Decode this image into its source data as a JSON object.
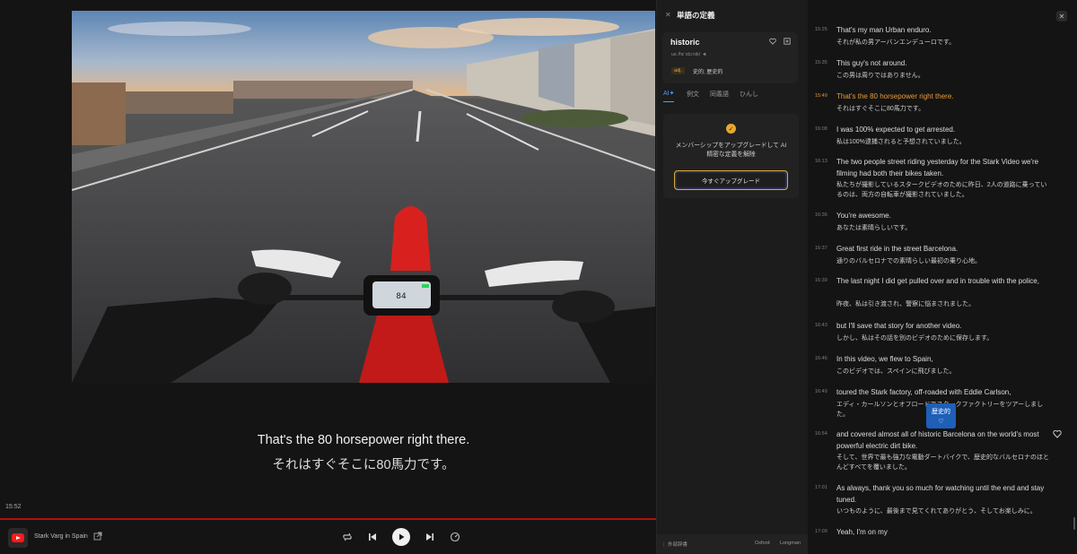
{
  "player": {
    "subtitle_en": "That's the 80 horsepower right there.",
    "subtitle_ja": "それはすぐそこに80馬力です。",
    "current_time": "15:52",
    "video_title": "Stark Varg in Spain",
    "dash_speed": "84"
  },
  "dictionary": {
    "title": "単語の定義",
    "word": "historic",
    "pronunciation": "us  /hɪˈstɔːrɪk/ ◄",
    "pos": "adj.",
    "meaning": "史的; 歴史的",
    "tabs": [
      "AI✦",
      "例文",
      "同義語",
      "ひんし"
    ],
    "upgrade_text": "メンバーシップをアップグレードして AI 精密な定義を解除",
    "upgrade_button": "今すぐアップグレード",
    "footer_left": "⋮ 外部辞書",
    "footer_oxford": "Oxford",
    "footer_longman": "Longman"
  },
  "transcript": {
    "lines": [
      {
        "ts": "15:25",
        "en": "That's my man Urban enduro.",
        "ja": "それが私の男アーバンエンデューロです。"
      },
      {
        "ts": "15:35",
        "en": "This guy's not around.",
        "ja": "この男は周りではありません。"
      },
      {
        "ts": "15:49",
        "en": "That's the 80 horsepower right there.",
        "ja": "それはすぐそこに80馬力です。"
      },
      {
        "ts": "16:08",
        "en": "I was 100% expected to get arrested.",
        "ja": "私は100%逮捕されると予想されていました。"
      },
      {
        "ts": "16:13",
        "en": "The two people street riding yesterday for the Stark Video we're filming had both their bikes taken.",
        "ja": "私たちが撮影しているスタークビデオのために昨日、2人の道路に乗っているのは、両方の自転車が撮影されていました。"
      },
      {
        "ts": "16:36",
        "en": "You're awesome.",
        "ja": "あなたは素晴らしいです。"
      },
      {
        "ts": "16:37",
        "en": "Great first ride in the street Barcelona.",
        "ja": "通りのバルセロナでの素晴らしい最初の乗り心地。"
      },
      {
        "ts": "16:39",
        "en": "The last night I did get pulled over and in trouble with the police,",
        "ja": "昨夜、私は引き渡され、警察に悩まされました。"
      },
      {
        "ts": "16:43",
        "en": "but I'll save that story for another video.",
        "ja": "しかし、私はその話を別のビデオのために保存します。"
      },
      {
        "ts": "16:46",
        "en": "In this video, we flew to Spain,",
        "ja": "このビデオでは、スペインに飛びました。"
      },
      {
        "ts": "16:49",
        "en": "toured the Stark factory, off-roaded with Eddie Carlson,",
        "ja": "エディ・カールソンとオフロードでスタークファクトリーをツアーしました。"
      },
      {
        "ts": "16:54",
        "en": "and covered almost all of historic Barcelona on the world's most powerful electric dirt bike.",
        "ja": "そして、世界で最も強力な電動ダートバイクで、歴史的なバルセロナのほとんどすべてを覆いました。"
      },
      {
        "ts": "17:01",
        "en": "As always, thank you so much for watching until the end and stay tuned.",
        "ja": "いつものように、最後まで見てくれてありがとう、そしてお楽しみに。"
      },
      {
        "ts": "17:09",
        "en": "Yeah, I'm on my",
        "ja": ""
      }
    ],
    "popup_word": "歴史的",
    "popup_heart": "♡"
  },
  "colors": {
    "active_line": "#e99a3b",
    "progress": "#b01010",
    "accent_blue": "#4f9cff",
    "popup": "#1e5fb8"
  }
}
